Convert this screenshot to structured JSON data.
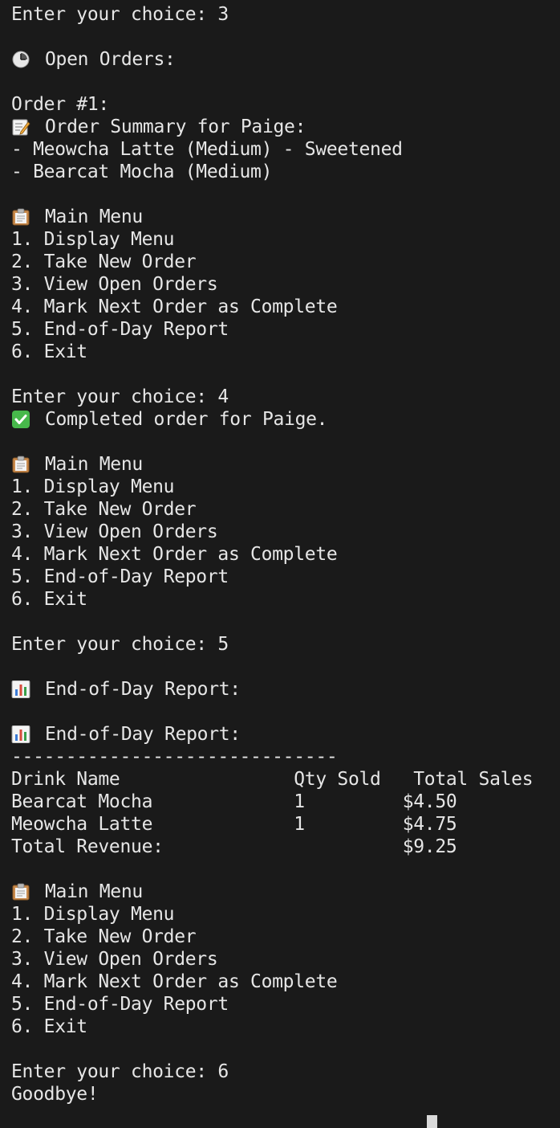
{
  "terminal": {
    "prompt_choice_3": "Enter your choice: 3",
    "open_orders_heading": "Open Orders:",
    "order_number": "Order #1:",
    "order_summary": "Order Summary for Paige:",
    "order_item_1": "- Meowcha Latte (Medium) - Sweetened",
    "order_item_2": "- Bearcat Mocha (Medium)",
    "menu": {
      "title": "Main Menu",
      "items": [
        "1. Display Menu",
        "2. Take New Order",
        "3. View Open Orders",
        "4. Mark Next Order as Complete",
        "5. End-of-Day Report",
        "6. Exit"
      ]
    },
    "prompt_choice_4": "Enter your choice: 4",
    "completed_message": "Completed order for Paige.",
    "prompt_choice_5": "Enter your choice: 5",
    "report_heading": "End-of-Day Report:",
    "report_separator": "------------------------------",
    "report_header": "Drink Name                Qty Sold   Total Sales",
    "report_rows": [
      "Bearcat Mocha             1         $4.50",
      "Meowcha Latte             1         $4.75"
    ],
    "report_total": "Total Revenue:                      $9.25",
    "prompt_choice_6": "Enter your choice: 6",
    "goodbye": "Goodbye!"
  },
  "icons": {
    "clock": "clock-icon",
    "memo": "memo-icon",
    "clipboard": "clipboard-icon",
    "check": "check-mark-icon",
    "chart": "bar-chart-icon"
  },
  "colors": {
    "background": "#1a1a1a",
    "text": "#e6e6e6",
    "check_green": "#47b84b"
  }
}
